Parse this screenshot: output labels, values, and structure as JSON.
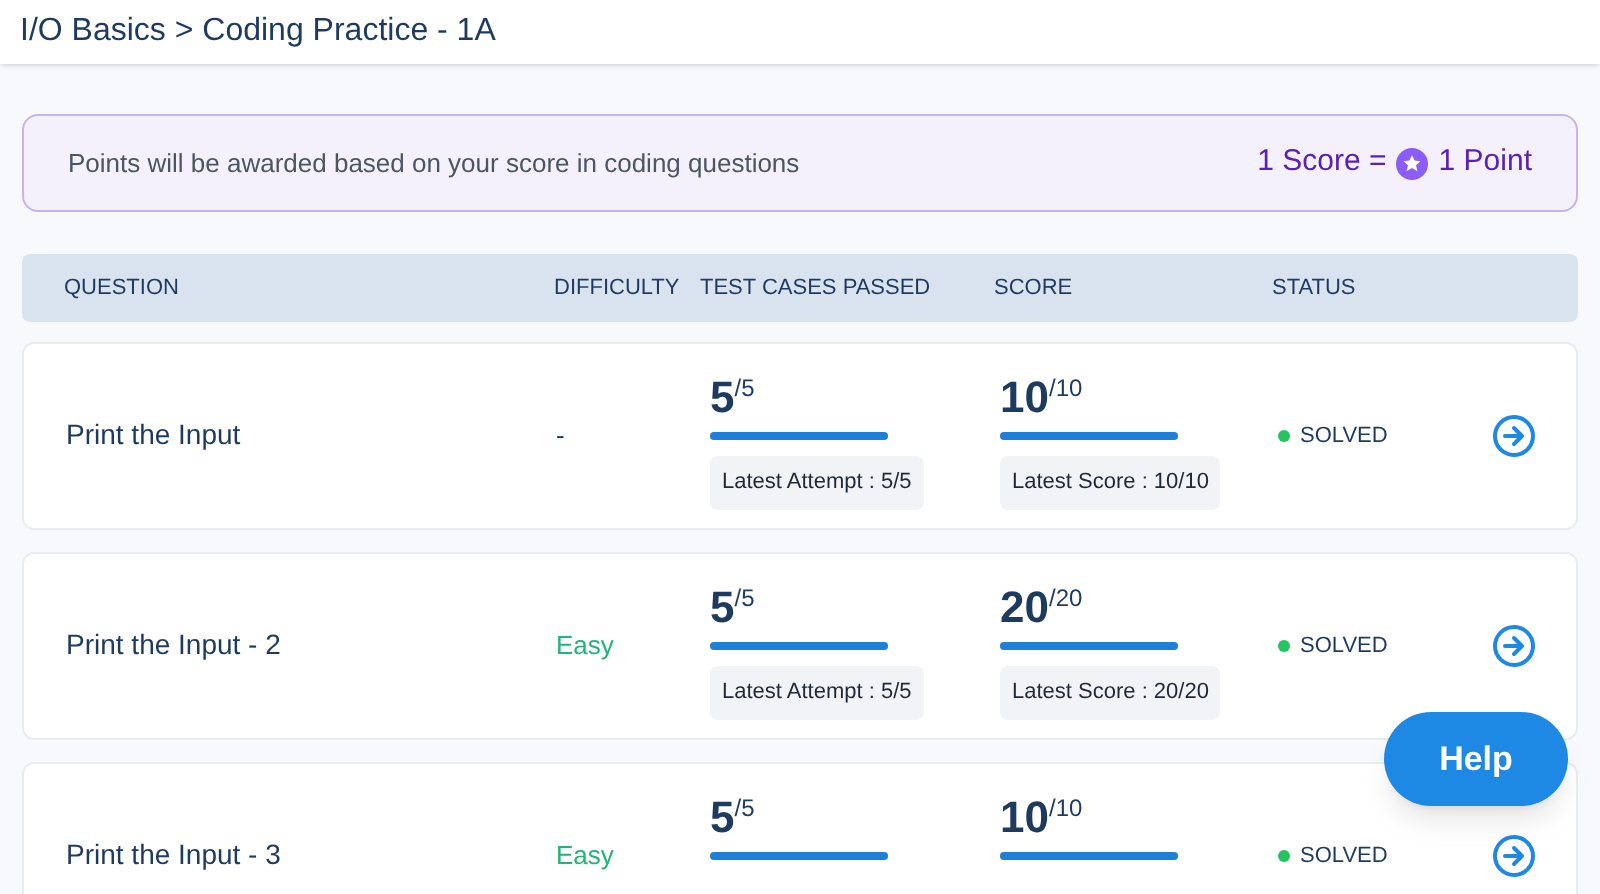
{
  "breadcrumb": "I/O Basics > Coding Practice - 1A",
  "banner": {
    "text": "Points will be awarded based on your score in coding questions",
    "rate_left": "1 Score =",
    "rate_right": "1 Point"
  },
  "table": {
    "columns": [
      "QUESTION",
      "DIFFICULTY",
      "TEST CASES PASSED",
      "SCORE",
      "STATUS"
    ],
    "rows": [
      {
        "question": "Print the Input",
        "difficulty": {
          "text": "-",
          "color": "#1e3a5f"
        },
        "tests": {
          "value": "5",
          "total": "/5",
          "level": 1,
          "latest": "Latest Attempt : 5/5"
        },
        "score": {
          "value": "10",
          "total": "/10",
          "level": 1,
          "latest": "Latest Score : 10/10"
        },
        "status": "SOLVED",
        "color": "#22c55e"
      },
      {
        "question": "Print the Input - 2",
        "difficulty": {
          "text": "Easy",
          "color": "#22b573"
        },
        "tests": {
          "value": "5",
          "total": "/5",
          "level": 1,
          "latest": "Latest Attempt : 5/5"
        },
        "score": {
          "value": "20",
          "total": "/20",
          "level": 1,
          "latest": "Latest Score : 20/20"
        },
        "status": "SOLVED",
        "color": "#22c55e"
      },
      {
        "question": "Print the Input - 3",
        "difficulty": {
          "text": "Easy",
          "color": "#22b573"
        },
        "tests": {
          "value": "5",
          "total": "/5",
          "level": 1
        },
        "score": {
          "value": "10",
          "total": "/10",
          "level": 1
        },
        "status": "SOLVED",
        "color": "#22c55e"
      }
    ]
  },
  "help_button": "Help"
}
